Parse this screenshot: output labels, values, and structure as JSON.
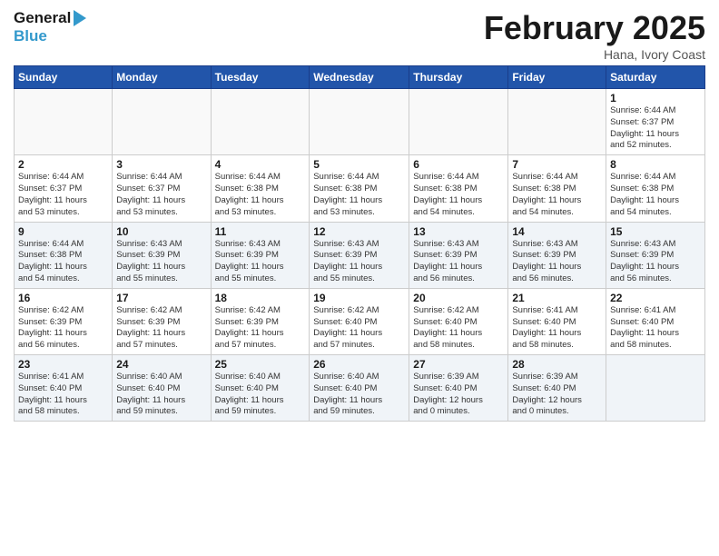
{
  "header": {
    "logo_general": "General",
    "logo_blue": "Blue",
    "title": "February 2025",
    "subtitle": "Hana, Ivory Coast"
  },
  "days_of_week": [
    "Sunday",
    "Monday",
    "Tuesday",
    "Wednesday",
    "Thursday",
    "Friday",
    "Saturday"
  ],
  "weeks": [
    {
      "shade": false,
      "days": [
        {
          "num": "",
          "info": ""
        },
        {
          "num": "",
          "info": ""
        },
        {
          "num": "",
          "info": ""
        },
        {
          "num": "",
          "info": ""
        },
        {
          "num": "",
          "info": ""
        },
        {
          "num": "",
          "info": ""
        },
        {
          "num": "1",
          "info": "Sunrise: 6:44 AM\nSunset: 6:37 PM\nDaylight: 11 hours\nand 52 minutes."
        }
      ]
    },
    {
      "shade": false,
      "days": [
        {
          "num": "2",
          "info": "Sunrise: 6:44 AM\nSunset: 6:37 PM\nDaylight: 11 hours\nand 53 minutes."
        },
        {
          "num": "3",
          "info": "Sunrise: 6:44 AM\nSunset: 6:37 PM\nDaylight: 11 hours\nand 53 minutes."
        },
        {
          "num": "4",
          "info": "Sunrise: 6:44 AM\nSunset: 6:38 PM\nDaylight: 11 hours\nand 53 minutes."
        },
        {
          "num": "5",
          "info": "Sunrise: 6:44 AM\nSunset: 6:38 PM\nDaylight: 11 hours\nand 53 minutes."
        },
        {
          "num": "6",
          "info": "Sunrise: 6:44 AM\nSunset: 6:38 PM\nDaylight: 11 hours\nand 54 minutes."
        },
        {
          "num": "7",
          "info": "Sunrise: 6:44 AM\nSunset: 6:38 PM\nDaylight: 11 hours\nand 54 minutes."
        },
        {
          "num": "8",
          "info": "Sunrise: 6:44 AM\nSunset: 6:38 PM\nDaylight: 11 hours\nand 54 minutes."
        }
      ]
    },
    {
      "shade": true,
      "days": [
        {
          "num": "9",
          "info": "Sunrise: 6:44 AM\nSunset: 6:38 PM\nDaylight: 11 hours\nand 54 minutes."
        },
        {
          "num": "10",
          "info": "Sunrise: 6:43 AM\nSunset: 6:39 PM\nDaylight: 11 hours\nand 55 minutes."
        },
        {
          "num": "11",
          "info": "Sunrise: 6:43 AM\nSunset: 6:39 PM\nDaylight: 11 hours\nand 55 minutes."
        },
        {
          "num": "12",
          "info": "Sunrise: 6:43 AM\nSunset: 6:39 PM\nDaylight: 11 hours\nand 55 minutes."
        },
        {
          "num": "13",
          "info": "Sunrise: 6:43 AM\nSunset: 6:39 PM\nDaylight: 11 hours\nand 56 minutes."
        },
        {
          "num": "14",
          "info": "Sunrise: 6:43 AM\nSunset: 6:39 PM\nDaylight: 11 hours\nand 56 minutes."
        },
        {
          "num": "15",
          "info": "Sunrise: 6:43 AM\nSunset: 6:39 PM\nDaylight: 11 hours\nand 56 minutes."
        }
      ]
    },
    {
      "shade": false,
      "days": [
        {
          "num": "16",
          "info": "Sunrise: 6:42 AM\nSunset: 6:39 PM\nDaylight: 11 hours\nand 56 minutes."
        },
        {
          "num": "17",
          "info": "Sunrise: 6:42 AM\nSunset: 6:39 PM\nDaylight: 11 hours\nand 57 minutes."
        },
        {
          "num": "18",
          "info": "Sunrise: 6:42 AM\nSunset: 6:39 PM\nDaylight: 11 hours\nand 57 minutes."
        },
        {
          "num": "19",
          "info": "Sunrise: 6:42 AM\nSunset: 6:40 PM\nDaylight: 11 hours\nand 57 minutes."
        },
        {
          "num": "20",
          "info": "Sunrise: 6:42 AM\nSunset: 6:40 PM\nDaylight: 11 hours\nand 58 minutes."
        },
        {
          "num": "21",
          "info": "Sunrise: 6:41 AM\nSunset: 6:40 PM\nDaylight: 11 hours\nand 58 minutes."
        },
        {
          "num": "22",
          "info": "Sunrise: 6:41 AM\nSunset: 6:40 PM\nDaylight: 11 hours\nand 58 minutes."
        }
      ]
    },
    {
      "shade": true,
      "days": [
        {
          "num": "23",
          "info": "Sunrise: 6:41 AM\nSunset: 6:40 PM\nDaylight: 11 hours\nand 58 minutes."
        },
        {
          "num": "24",
          "info": "Sunrise: 6:40 AM\nSunset: 6:40 PM\nDaylight: 11 hours\nand 59 minutes."
        },
        {
          "num": "25",
          "info": "Sunrise: 6:40 AM\nSunset: 6:40 PM\nDaylight: 11 hours\nand 59 minutes."
        },
        {
          "num": "26",
          "info": "Sunrise: 6:40 AM\nSunset: 6:40 PM\nDaylight: 11 hours\nand 59 minutes."
        },
        {
          "num": "27",
          "info": "Sunrise: 6:39 AM\nSunset: 6:40 PM\nDaylight: 12 hours\nand 0 minutes."
        },
        {
          "num": "28",
          "info": "Sunrise: 6:39 AM\nSunset: 6:40 PM\nDaylight: 12 hours\nand 0 minutes."
        },
        {
          "num": "",
          "info": ""
        }
      ]
    }
  ]
}
